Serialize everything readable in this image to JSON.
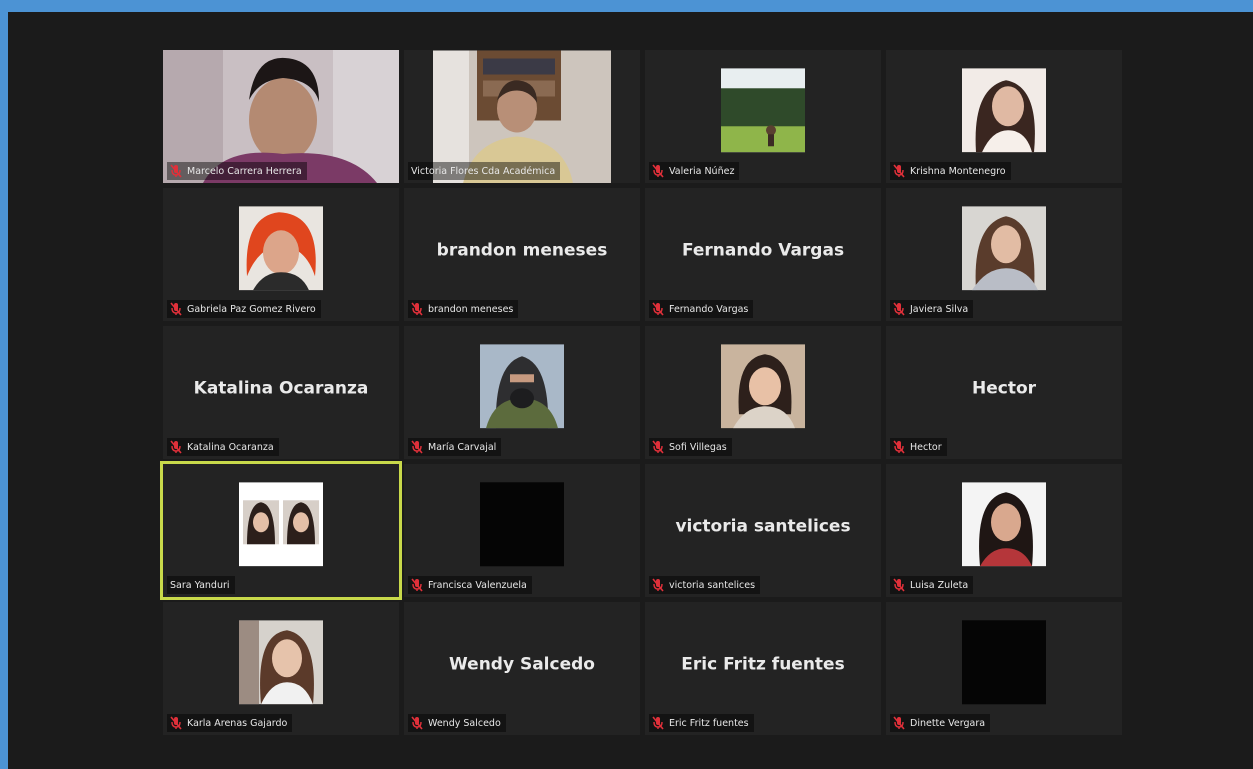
{
  "colors": {
    "desktop": "#4c93d4",
    "window_bg": "#1b1b1b",
    "tile_bg": "#232323",
    "active_speaker_border": "#c8d94a",
    "mute_icon": "#e0303a"
  },
  "participants": [
    {
      "label": "Marcelo Carrera Herrera",
      "video": "camera",
      "muted": true
    },
    {
      "label": "Victoria Flores Cda Académica",
      "video": "camera",
      "muted": false
    },
    {
      "label": "Valeria Núñez",
      "video": "photo",
      "muted": true
    },
    {
      "label": "Krishna Montenegro",
      "video": "photo",
      "muted": true
    },
    {
      "label": "Gabriela Paz Gomez Rivero",
      "video": "photo",
      "muted": true
    },
    {
      "label": "brandon meneses",
      "display_name": "brandon meneses",
      "video": "name",
      "muted": true
    },
    {
      "label": "Fernando Vargas",
      "display_name": "Fernando Vargas",
      "video": "name",
      "muted": true
    },
    {
      "label": "Javiera Silva",
      "video": "photo",
      "muted": true
    },
    {
      "label": "Katalina Ocaranza",
      "display_name": "Katalina Ocaranza",
      "video": "name",
      "muted": true
    },
    {
      "label": "María Carvajal",
      "video": "photo",
      "muted": true
    },
    {
      "label": "Sofi Villegas",
      "video": "photo",
      "muted": true
    },
    {
      "label": "Hector",
      "display_name": "Hector",
      "video": "name",
      "muted": true
    },
    {
      "label": "Sara Yanduri",
      "video": "photo",
      "muted": false,
      "active": true
    },
    {
      "label": "Francisca Valenzuela",
      "video": "black",
      "muted": true
    },
    {
      "label": "victoria santelices",
      "display_name": "victoria santelices",
      "video": "name",
      "muted": true
    },
    {
      "label": "Luisa Zuleta",
      "video": "photo",
      "muted": true
    },
    {
      "label": "Karla Arenas Gajardo",
      "video": "photo",
      "muted": true
    },
    {
      "label": "Wendy Salcedo",
      "display_name": "Wendy Salcedo",
      "video": "name",
      "muted": true
    },
    {
      "label": "Eric Fritz fuentes",
      "display_name": "Eric Fritz fuentes",
      "video": "name",
      "muted": true
    },
    {
      "label": "Dinette Vergara",
      "video": "black",
      "muted": true
    }
  ]
}
